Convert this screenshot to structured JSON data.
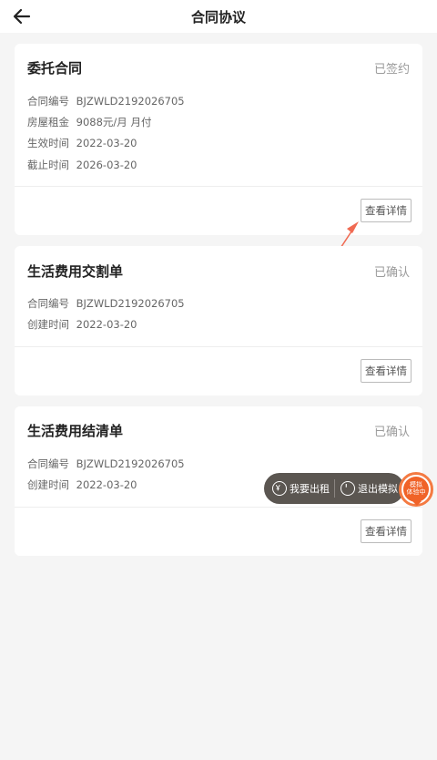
{
  "header": {
    "title": "合同协议"
  },
  "cards": [
    {
      "title": "委托合同",
      "status": "已签约",
      "rows": [
        {
          "label": "合同编号",
          "value": "BJZWLD2192026705"
        },
        {
          "label": "房屋租金",
          "value": "9088元/月 月付"
        },
        {
          "label": "生效时间",
          "value": "2022-03-20"
        },
        {
          "label": "截止时间",
          "value": "2026-03-20"
        }
      ],
      "button": "查看详情"
    },
    {
      "title": "生活费用交割单",
      "status": "已确认",
      "rows": [
        {
          "label": "合同编号",
          "value": "BJZWLD2192026705"
        },
        {
          "label": "创建时间",
          "value": "2022-03-20"
        }
      ],
      "button": "查看详情"
    },
    {
      "title": "生活费用结清单",
      "status": "已确认",
      "rows": [
        {
          "label": "合同编号",
          "value": "BJZWLD2192026705"
        },
        {
          "label": "创建时间",
          "value": "2022-03-20"
        }
      ],
      "button": "查看详情"
    }
  ],
  "floating": {
    "rent_label": "我要出租",
    "exit_label": "退出模拟",
    "badge_line1": "模拟",
    "badge_line2": "体验中"
  },
  "icons": {
    "back": "arrow-left-icon",
    "rent": "rent-icon",
    "exit": "power-icon"
  },
  "colors": {
    "accent": "#f06328",
    "annotation_arrow": "#f06a52",
    "floating_bar": "#5b5651"
  }
}
